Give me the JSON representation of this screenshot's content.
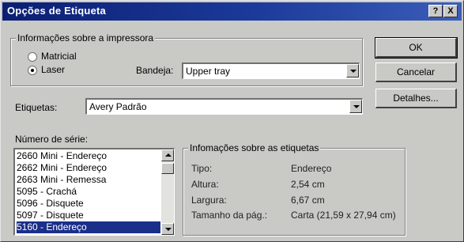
{
  "window": {
    "title": "Opções de Etiqueta",
    "help_button": "?",
    "close_button": "X"
  },
  "printer_group": {
    "label": "Informações sobre a impressora",
    "radios": [
      {
        "label": "Matricial",
        "checked": false
      },
      {
        "label": "Laser",
        "checked": true
      }
    ],
    "tray_label": "Bandeja:",
    "tray_value": "Upper tray"
  },
  "labels_field": {
    "label": "Etiquetas:",
    "value": "Avery Padrão"
  },
  "serial": {
    "label": "Número de série:",
    "items": [
      "2660 Mini - Endereço",
      "2662 Mini - Endereço",
      "2663 Mini - Remessa",
      "5095 - Crachá",
      "5096 - Disquete",
      "5097 - Disquete",
      "5160 - Endereço"
    ],
    "selected_index": 6
  },
  "label_info": {
    "label": "Infomações sobre as etiquetas",
    "rows": [
      {
        "key": "Tipo:",
        "value": "Endereço"
      },
      {
        "key": "Altura:",
        "value": "2,54 cm"
      },
      {
        "key": "Largura:",
        "value": "6,67 cm"
      },
      {
        "key": "Tamanho da pág.:",
        "value": "Carta (21,59 x 27,94 cm)"
      }
    ]
  },
  "buttons": {
    "ok": "OK",
    "cancel": "Cancelar",
    "details": "Detalhes..."
  },
  "colors": {
    "title_bar": "#0b1f73",
    "dialog_face": "#c9c9c6",
    "selection": "#1a2f8a"
  }
}
